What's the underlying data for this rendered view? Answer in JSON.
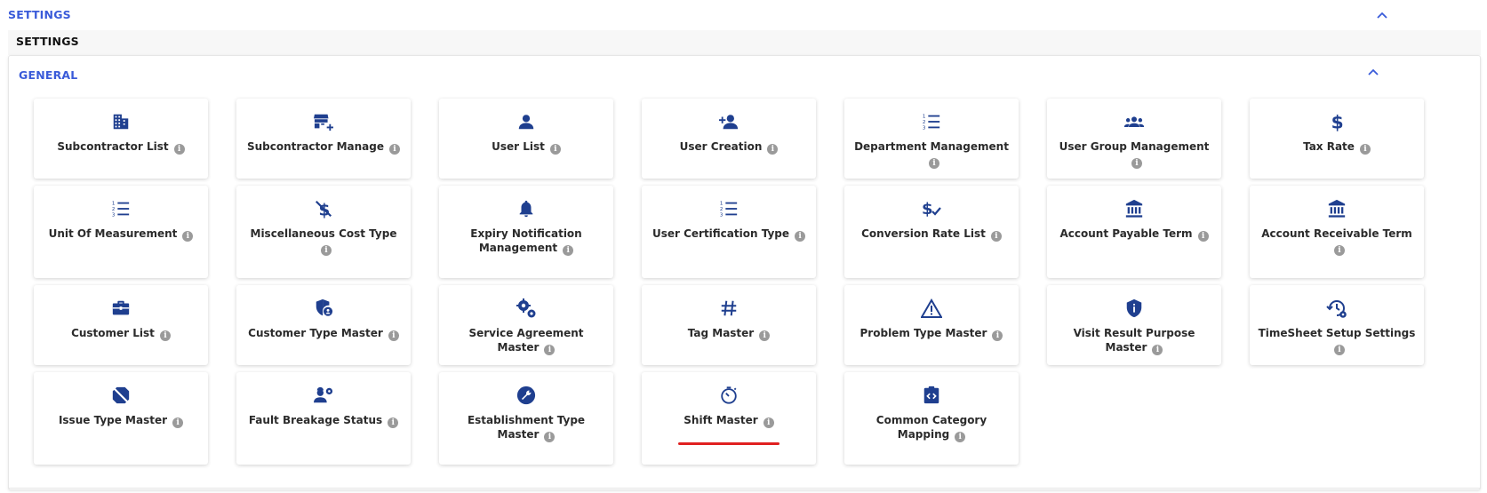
{
  "header": {
    "title": "SETTINGS"
  },
  "subheader": {
    "title": "SETTINGS"
  },
  "general": {
    "title": "GENERAL",
    "items": [
      {
        "label": "Subcontractor List",
        "icon": "building-icon"
      },
      {
        "label": "Subcontractor Manage",
        "icon": "store-add-icon"
      },
      {
        "label": "User List",
        "icon": "user-icon"
      },
      {
        "label": "User Creation",
        "icon": "user-add-icon"
      },
      {
        "label": "Department Management",
        "icon": "numbered-list-icon"
      },
      {
        "label": "User Group Management",
        "icon": "user-group-icon"
      },
      {
        "label": "Tax Rate",
        "icon": "dollar-icon"
      },
      {
        "label": "Unit Of Measurement",
        "icon": "numbered-list-icon"
      },
      {
        "label": "Miscellaneous Cost Type",
        "icon": "money-off-icon"
      },
      {
        "label": "Expiry Notification Management",
        "icon": "bell-icon"
      },
      {
        "label": "User Certification Type",
        "icon": "numbered-list-icon"
      },
      {
        "label": "Conversion Rate List",
        "icon": "price-check-icon"
      },
      {
        "label": "Account Payable Term",
        "icon": "bank-icon"
      },
      {
        "label": "Account Receivable Term",
        "icon": "bank-icon"
      },
      {
        "label": "Customer List",
        "icon": "briefcase-icon"
      },
      {
        "label": "Customer Type Master",
        "icon": "shield-user-icon"
      },
      {
        "label": "Service Agreement Master",
        "icon": "gears-icon"
      },
      {
        "label": "Tag Master",
        "icon": "hashtag-icon"
      },
      {
        "label": "Problem Type Master",
        "icon": "warning-icon"
      },
      {
        "label": "Visit Result Purpose Master",
        "icon": "info-shield-icon"
      },
      {
        "label": "TimeSheet Setup Settings",
        "icon": "history-gear-icon"
      },
      {
        "label": "Issue Type Master",
        "icon": "bug-off-icon"
      },
      {
        "label": "Fault Breakage Status",
        "icon": "worker-gear-icon"
      },
      {
        "label": "Establishment Type Master",
        "icon": "wrench-icon"
      },
      {
        "label": "Shift Master",
        "icon": "timer-icon"
      },
      {
        "label": "Common Category Mapping",
        "icon": "code-clipboard-icon"
      }
    ]
  },
  "info_glyph": "i",
  "colors": {
    "accent": "#3a5bd9",
    "icon": "#1f3f8f",
    "highlight": "#e02020"
  }
}
